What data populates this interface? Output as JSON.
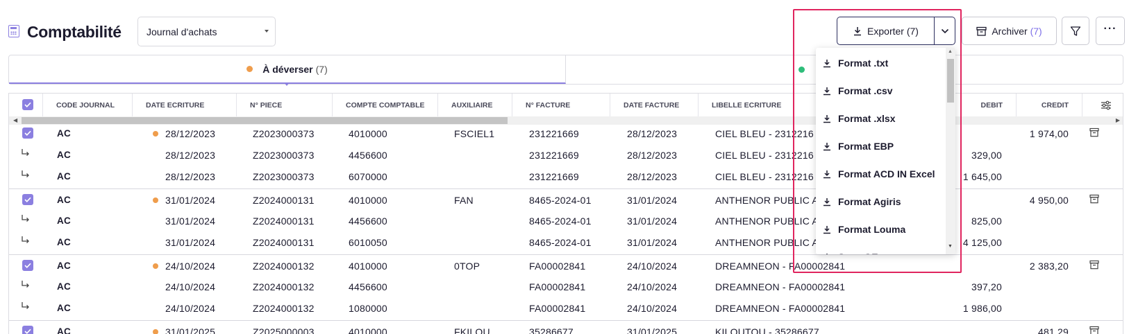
{
  "header": {
    "title": "Comptabilité",
    "journal_select": "Journal d'achats",
    "export_label": "Exporter",
    "export_count": "(7)",
    "archive_label": "Archiver",
    "archive_count": "(7)"
  },
  "tabs": [
    {
      "label": "À déverser",
      "count": "(7)",
      "status_color": "#ef9d4c",
      "active": true
    },
    {
      "label": "",
      "count": "",
      "status_color": "#2ebd7a",
      "active": false
    }
  ],
  "table": {
    "columns": [
      "CODE JOURNAL",
      "DATE ECRITURE",
      "N° PIECE",
      "COMPTE COMPTABLE",
      "AUXILIAIRE",
      "N° FACTURE",
      "DATE FACTURE",
      "LIBELLE ECRITURE",
      "DEBIT",
      "CREDIT"
    ],
    "rows": [
      {
        "type": "main",
        "code": "AC",
        "date": "28/12/2023",
        "piece": "Z2023000373",
        "compte": "4010000",
        "aux": "FSCIEL1",
        "facture": "231221669",
        "date_facture": "28/12/2023",
        "libelle": "CIEL BLEU - 2312216",
        "debit": "",
        "credit": "1 974,00"
      },
      {
        "type": "sub",
        "code": "AC",
        "date": "28/12/2023",
        "piece": "Z2023000373",
        "compte": "4456600",
        "aux": "",
        "facture": "231221669",
        "date_facture": "28/12/2023",
        "libelle": "CIEL BLEU - 2312216",
        "debit": "329,00",
        "credit": ""
      },
      {
        "type": "sub",
        "code": "AC",
        "date": "28/12/2023",
        "piece": "Z2023000373",
        "compte": "6070000",
        "aux": "",
        "facture": "231221669",
        "date_facture": "28/12/2023",
        "libelle": "CIEL BLEU - 2312216",
        "debit": "1 645,00",
        "credit": ""
      },
      {
        "type": "main",
        "code": "AC",
        "date": "31/01/2024",
        "piece": "Z2024000131",
        "compte": "4010000",
        "aux": "FAN",
        "facture": "8465-2024-01",
        "date_facture": "31/01/2024",
        "libelle": "ANTHENOR PUBLIC AF",
        "debit": "",
        "credit": "4 950,00"
      },
      {
        "type": "sub",
        "code": "AC",
        "date": "31/01/2024",
        "piece": "Z2024000131",
        "compte": "4456600",
        "aux": "",
        "facture": "8465-2024-01",
        "date_facture": "31/01/2024",
        "libelle": "ANTHENOR PUBLIC AF",
        "debit": "825,00",
        "credit": ""
      },
      {
        "type": "sub",
        "code": "AC",
        "date": "31/01/2024",
        "piece": "Z2024000131",
        "compte": "6010050",
        "aux": "",
        "facture": "8465-2024-01",
        "date_facture": "31/01/2024",
        "libelle": "ANTHENOR PUBLIC AF",
        "debit": "4 125,00",
        "credit": ""
      },
      {
        "type": "main",
        "code": "AC",
        "date": "24/10/2024",
        "piece": "Z2024000132",
        "compte": "4010000",
        "aux": "0TOP",
        "facture": "FA00002841",
        "date_facture": "24/10/2024",
        "libelle": "DREAMNEON - FA00002841",
        "debit": "",
        "credit": "2 383,20"
      },
      {
        "type": "sub",
        "code": "AC",
        "date": "24/10/2024",
        "piece": "Z2024000132",
        "compte": "4456600",
        "aux": "",
        "facture": "FA00002841",
        "date_facture": "24/10/2024",
        "libelle": "DREAMNEON - FA00002841",
        "debit": "397,20",
        "credit": ""
      },
      {
        "type": "sub",
        "code": "AC",
        "date": "24/10/2024",
        "piece": "Z2024000132",
        "compte": "1080000",
        "aux": "",
        "facture": "FA00002841",
        "date_facture": "24/10/2024",
        "libelle": "DREAMNEON - FA00002841",
        "debit": "1 986,00",
        "credit": ""
      },
      {
        "type": "main",
        "code": "AC",
        "date": "31/01/2025",
        "piece": "Z2025000003",
        "compte": "4010000",
        "aux": "FKILOU",
        "facture": "35286677",
        "date_facture": "31/01/2025",
        "libelle": "KILOUTOU - 35286677",
        "debit": "",
        "credit": "481,29"
      }
    ]
  },
  "export_menu": {
    "items": [
      "Format .txt",
      "Format .csv",
      "Format .xlsx",
      "Format EBP",
      "Format ACD IN Excel",
      "Format Agiris",
      "Format Louma",
      "Sage GE sans"
    ]
  },
  "colors": {
    "accent": "#8b7fe0",
    "pending": "#ef9d4c",
    "done": "#2ebd7a",
    "highlight": "#e0245e"
  }
}
